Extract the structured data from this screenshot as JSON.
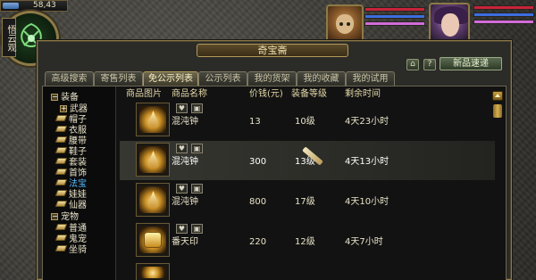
{
  "hud": {
    "coord_value": "58,43",
    "character_name": "悟云观"
  },
  "window": {
    "title": "奇宝斋",
    "help_icon": "?",
    "item_guide_label": "新品速递"
  },
  "tabs": [
    {
      "label": "高级搜索",
      "active": false
    },
    {
      "label": "寄售列表",
      "active": false
    },
    {
      "label": "免公示列表",
      "active": true
    },
    {
      "label": "公示列表",
      "active": false
    },
    {
      "label": "我的货架",
      "active": false
    },
    {
      "label": "我的收藏",
      "active": false
    },
    {
      "label": "我的试用",
      "active": false
    }
  ],
  "tree": [
    {
      "label": "装备",
      "type": "group",
      "expanded": true
    },
    {
      "label": "武器",
      "type": "group",
      "expanded": false
    },
    {
      "label": "帽子",
      "type": "leaf"
    },
    {
      "label": "衣服",
      "type": "leaf"
    },
    {
      "label": "腰带",
      "type": "leaf"
    },
    {
      "label": "鞋子",
      "type": "leaf"
    },
    {
      "label": "套装",
      "type": "leaf"
    },
    {
      "label": "首饰",
      "type": "leaf"
    },
    {
      "label": "法宝",
      "type": "leaf",
      "selected": true
    },
    {
      "label": "娃娃",
      "type": "leaf"
    },
    {
      "label": "仙器",
      "type": "leaf"
    },
    {
      "label": "宠物",
      "type": "group",
      "expanded": true
    },
    {
      "label": "普通",
      "type": "leaf"
    },
    {
      "label": "鬼宠",
      "type": "leaf"
    },
    {
      "label": "坐骑",
      "type": "leaf"
    }
  ],
  "table": {
    "headers": [
      "商品图片",
      "商品名称",
      "价钱(元)",
      "装备等级",
      "剩余时间"
    ],
    "rows": [
      {
        "name": "混沌钟",
        "price": "13",
        "level": "10级",
        "time_left": "4天23小时",
        "icon": "bell-icon",
        "selected": false
      },
      {
        "name": "混沌钟",
        "price": "300",
        "level": "13级",
        "time_left": "4天13小时",
        "icon": "bell-icon",
        "selected": true
      },
      {
        "name": "混沌钟",
        "price": "800",
        "level": "17级",
        "time_left": "4天10小时",
        "icon": "bell-icon",
        "selected": false
      },
      {
        "name": "番天印",
        "price": "220",
        "level": "12级",
        "time_left": "4天7小时",
        "icon": "seal-icon",
        "selected": false
      }
    ]
  },
  "colors": {
    "accent_gold": "#b39a5c",
    "selected_tree_text": "#52b8ff",
    "hp_bar": "#c8233a",
    "mp_bar": "#3c6ee0",
    "exp_bar": "#d06cd8"
  }
}
